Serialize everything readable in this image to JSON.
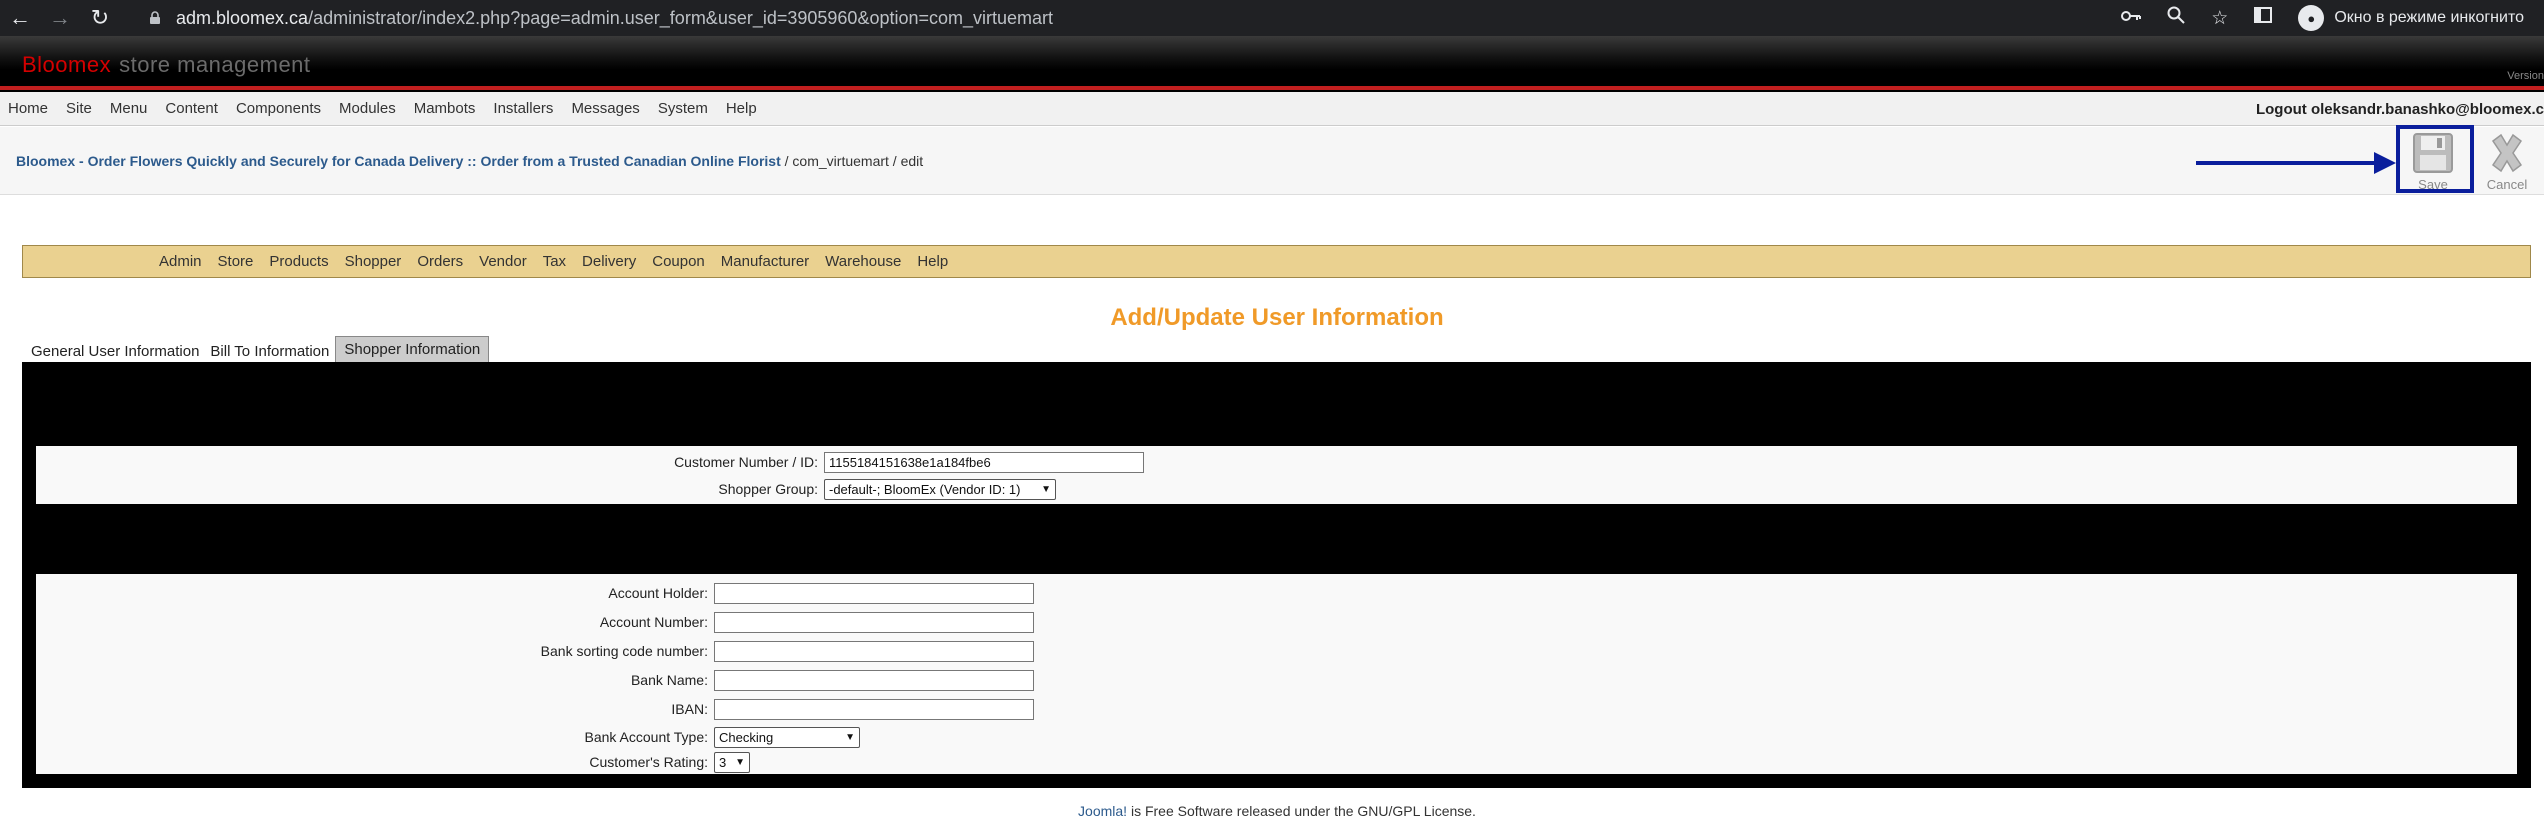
{
  "browser": {
    "url_host": "adm.bloomex.ca",
    "url_path": "/administrator/index2.php?page=admin.user_form&user_id=3905960&option=com_virtuemart",
    "incognito_label": "Окно в режиме инкогнито"
  },
  "header": {
    "brand_red": "Bloomex",
    "brand_grey": "store management",
    "version": "Version"
  },
  "top_menu": {
    "items": [
      "Home",
      "Site",
      "Menu",
      "Content",
      "Components",
      "Modules",
      "Mambots",
      "Installers",
      "Messages",
      "System",
      "Help"
    ],
    "logout": "Logout oleksandr.banashko@bloomex.c"
  },
  "title_bar": {
    "site_link": "Bloomex - Order Flowers Quickly and Securely for Canada Delivery :: Order from a Trusted Canadian Online Florist",
    "path": " / com_virtuemart / edit",
    "save_label": "Save",
    "cancel_label": "Cancel"
  },
  "sub_menu": {
    "items": [
      "Admin",
      "Store",
      "Products",
      "Shopper",
      "Orders",
      "Vendor",
      "Tax",
      "Delivery",
      "Coupon",
      "Manufacturer",
      "Warehouse",
      "Help"
    ]
  },
  "page_heading": "Add/Update User Information",
  "tabs": [
    "General User Information",
    "Bill To Information",
    "Shopper Information"
  ],
  "form": {
    "customer_number_label": "Customer Number / ID:",
    "customer_number_value": "1155184151638e1a184fbe6",
    "shopper_group_label": "Shopper Group:",
    "shopper_group_value": "-default-; BloomEx (Vendor ID: 1)",
    "account_holder_label": "Account Holder:",
    "account_number_label": "Account Number:",
    "bank_sorting_label": "Bank sorting code number:",
    "bank_name_label": "Bank Name:",
    "iban_label": "IBAN:",
    "bank_account_type_label": "Bank Account Type:",
    "bank_account_type_value": "Checking",
    "customer_rating_label": "Customer's Rating:",
    "customer_rating_value": "3"
  },
  "footer": {
    "link": "Joomla!",
    "text": " is Free Software released under the GNU/GPL License."
  },
  "colors": {
    "brand_red": "#d40000",
    "heading_orange": "#f09a28",
    "submenu_bg": "#ead190",
    "highlight_blue": "#0a1e9c"
  }
}
